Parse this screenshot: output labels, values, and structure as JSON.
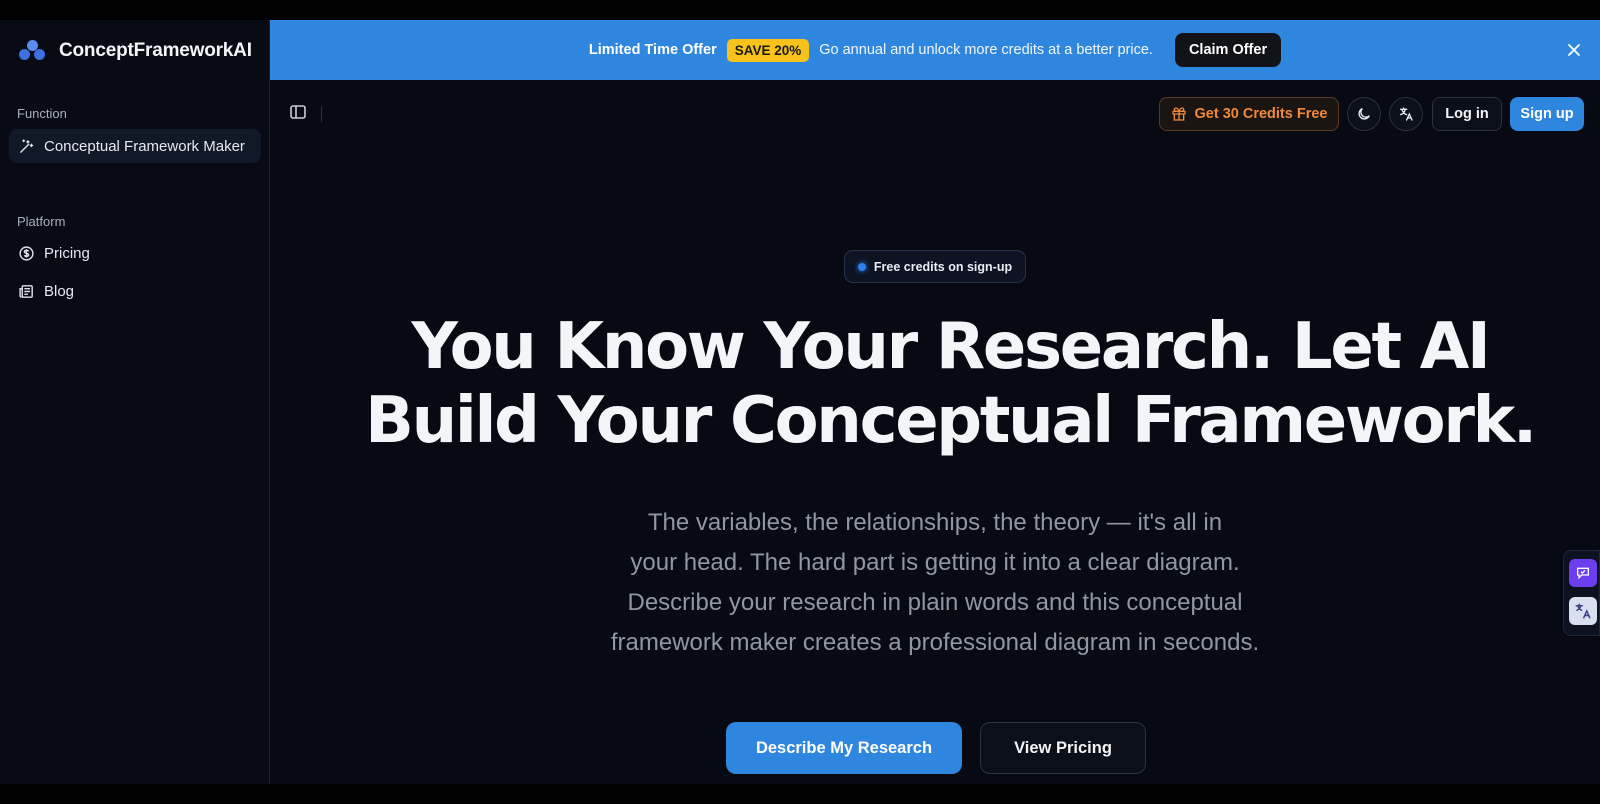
{
  "brand": {
    "name": "ConceptFrameworkAI",
    "logo_icon": "three-dot-cluster-icon",
    "accent": "#3d6fe0"
  },
  "sidebar": {
    "function_heading": "Function",
    "function_items": [
      {
        "label": "Conceptual Framework Maker",
        "icon": "magic-wand-icon",
        "active": true
      }
    ],
    "platform_heading": "Platform",
    "platform_items": [
      {
        "label": "Pricing",
        "icon": "dollar-circle-icon"
      },
      {
        "label": "Blog",
        "icon": "newspaper-icon"
      }
    ]
  },
  "banner": {
    "title": "Limited Time Offer",
    "badge": "SAVE 20%",
    "description": "Go annual and unlock more credits at a better price.",
    "cta": "Claim Offer",
    "color": "#2f86de"
  },
  "topbar": {
    "credits_label": "Get 30 Credits Free",
    "credits_icon": "gift-icon",
    "theme_icon": "moon-icon",
    "language_icon": "translate-icon",
    "login_label": "Log in",
    "signup_label": "Sign up"
  },
  "hero": {
    "pill_text": "Free credits on sign-up",
    "headline_line1": "You Know Your Research. Let AI",
    "headline_line2": "Build Your Conceptual Framework.",
    "sub_line1": "The variables, the relationships, the theory — it's all in",
    "sub_line2": "your head. The hard part is getting it into a clear diagram.",
    "sub_line3": "Describe your research in plain words and this conceptual",
    "sub_line4": "framework maker creates a professional diagram in seconds.",
    "primary_cta": "Describe My Research",
    "secondary_cta": "View Pricing"
  },
  "widgets": [
    {
      "icon": "chat-bubble-icon",
      "color": "#6d3df0"
    },
    {
      "icon": "translate-widget-icon",
      "color": "#d9def0"
    }
  ]
}
